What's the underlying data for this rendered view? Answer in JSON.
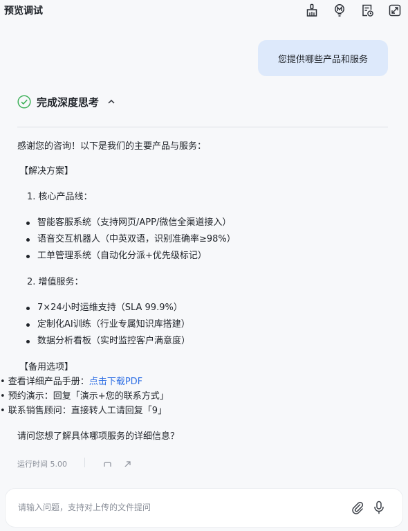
{
  "header": {
    "title": "预览调试"
  },
  "toolbar": {
    "icons": [
      "broom-icon",
      "model-m-icon",
      "document-clock-icon",
      "expand-icon"
    ]
  },
  "chat": {
    "user_message": "您提供哪些产品和服务",
    "thinking": {
      "label": "完成深度思考"
    },
    "answer": {
      "intro": "感谢您的咨询！以下是我们的主要产品与服务：",
      "section1": "【解决方案】",
      "list1_title": "1. 核心产品线：",
      "list1_items": [
        "智能客服系统（支持网页/APP/微信全渠道接入）",
        "语音交互机器人（中英双语，识别准确率≥98%）",
        "工单管理系统（自动化分派+优先级标记）"
      ],
      "list2_title": "2. 增值服务：",
      "list2_items": [
        "7×24小时运维支持（SLA 99.9%）",
        "定制化AI训练（行业专属知识库搭建）",
        "数据分析看板（实时监控客户满意度）"
      ],
      "section2": "【备用选项】",
      "option1_prefix": "• 查看详细产品手册：",
      "option1_link": "点击下载PDF",
      "option2": "• 预约演示：回复「演示+您的联系方式」",
      "option3": "• 联系销售顾问：直接转人工请回复「9」",
      "closing": "请问您想了解具体哪项服务的详细信息？"
    },
    "meta": {
      "runtime": "运行时间 5.00"
    }
  },
  "composer": {
    "placeholder": "请输入问题，支持对上传的文件提问"
  },
  "colors": {
    "accent": "#2f6fe4",
    "user_bubble": "#dde9fb",
    "check": "#3fb15a"
  }
}
